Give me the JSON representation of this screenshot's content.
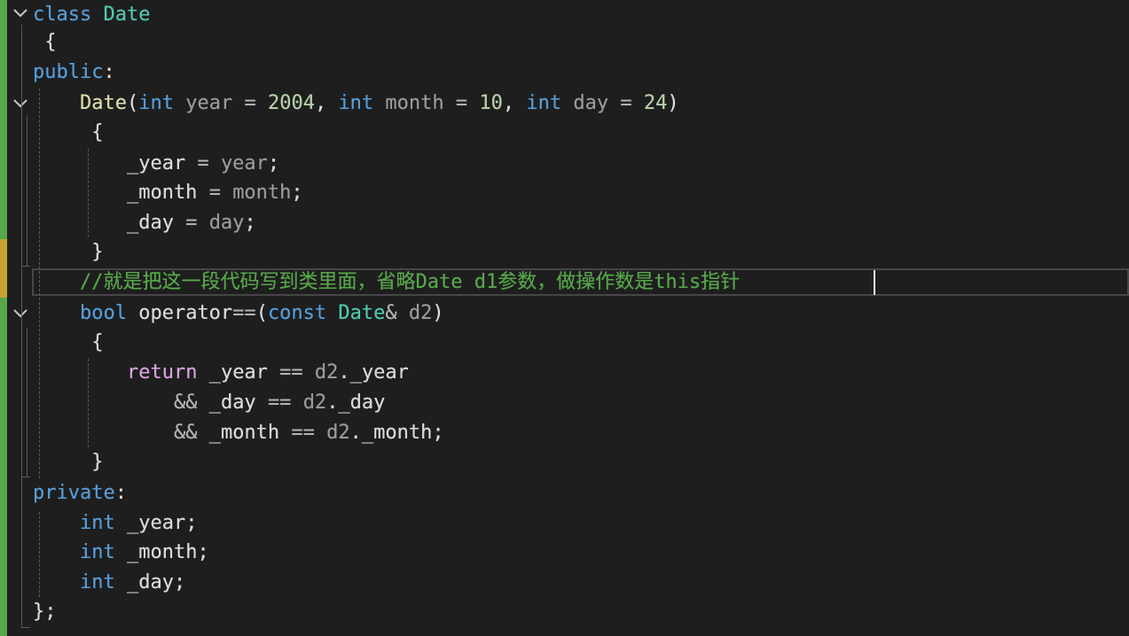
{
  "editor": {
    "theme_colors": {
      "background": "#1e1e1e",
      "keyword": "#569cd6",
      "type": "#4ec9b0",
      "function": "#dcdcaa",
      "number": "#b5cea8",
      "comment": "#57a64a",
      "parameter": "#9a9a9a",
      "control": "#d8a0df",
      "change_saved": "#57a64a",
      "change_unsaved": "#c5a332"
    },
    "fold_icon": "chevron-down-icon",
    "lines": [
      {
        "tokens": [
          {
            "t": "class",
            "c": "kw"
          },
          {
            "t": " ",
            "c": "id"
          },
          {
            "t": "Date",
            "c": "ty"
          }
        ]
      },
      {
        "tokens": [
          {
            "t": " {",
            "c": "id"
          }
        ]
      },
      {
        "tokens": [
          {
            "t": "public",
            "c": "kw"
          },
          {
            "t": ":",
            "c": "id"
          }
        ]
      },
      {
        "tokens": [
          {
            "t": "    ",
            "c": "id"
          },
          {
            "t": "Date",
            "c": "fn"
          },
          {
            "t": "(",
            "c": "id"
          },
          {
            "t": "int",
            "c": "kw"
          },
          {
            "t": " year ",
            "c": "pm"
          },
          {
            "t": "= ",
            "c": "op"
          },
          {
            "t": "2004",
            "c": "num"
          },
          {
            "t": ", ",
            "c": "id"
          },
          {
            "t": "int",
            "c": "kw"
          },
          {
            "t": " month ",
            "c": "pm"
          },
          {
            "t": "= ",
            "c": "op"
          },
          {
            "t": "10",
            "c": "num"
          },
          {
            "t": ", ",
            "c": "id"
          },
          {
            "t": "int",
            "c": "kw"
          },
          {
            "t": " day ",
            "c": "pm"
          },
          {
            "t": "= ",
            "c": "op"
          },
          {
            "t": "24",
            "c": "num"
          },
          {
            "t": ")",
            "c": "id"
          }
        ]
      },
      {
        "tokens": [
          {
            "t": "     {",
            "c": "id"
          }
        ]
      },
      {
        "tokens": [
          {
            "t": "        _year ",
            "c": "id"
          },
          {
            "t": "= ",
            "c": "op"
          },
          {
            "t": "year",
            "c": "pm"
          },
          {
            "t": ";",
            "c": "id"
          }
        ]
      },
      {
        "tokens": [
          {
            "t": "        _month ",
            "c": "id"
          },
          {
            "t": "= ",
            "c": "op"
          },
          {
            "t": "month",
            "c": "pm"
          },
          {
            "t": ";",
            "c": "id"
          }
        ]
      },
      {
        "tokens": [
          {
            "t": "        _day ",
            "c": "id"
          },
          {
            "t": "= ",
            "c": "op"
          },
          {
            "t": "day",
            "c": "pm"
          },
          {
            "t": ";",
            "c": "id"
          }
        ]
      },
      {
        "tokens": [
          {
            "t": "     }",
            "c": "id"
          }
        ]
      },
      {
        "tokens": [
          {
            "t": "    ",
            "c": "id"
          },
          {
            "t": "//就是把这一段代码写到类里面，省略Date d1参数，做操作数是this指针",
            "c": "cm"
          }
        ]
      },
      {
        "tokens": [
          {
            "t": "    ",
            "c": "id"
          },
          {
            "t": "bool",
            "c": "kw"
          },
          {
            "t": " operator",
            "c": "id"
          },
          {
            "t": "==",
            "c": "op"
          },
          {
            "t": "(",
            "c": "id"
          },
          {
            "t": "const",
            "c": "kw"
          },
          {
            "t": " ",
            "c": "id"
          },
          {
            "t": "Date",
            "c": "ty"
          },
          {
            "t": "& ",
            "c": "op"
          },
          {
            "t": "d2",
            "c": "pm"
          },
          {
            "t": ")",
            "c": "id"
          }
        ]
      },
      {
        "tokens": [
          {
            "t": "     {",
            "c": "id"
          }
        ]
      },
      {
        "tokens": [
          {
            "t": "        ",
            "c": "id"
          },
          {
            "t": "return",
            "c": "ctl"
          },
          {
            "t": " _year ",
            "c": "id"
          },
          {
            "t": "== ",
            "c": "op"
          },
          {
            "t": "d2",
            "c": "pm"
          },
          {
            "t": "._year",
            "c": "id"
          }
        ]
      },
      {
        "tokens": [
          {
            "t": "            ",
            "c": "id"
          },
          {
            "t": "&&",
            "c": "op"
          },
          {
            "t": " _day ",
            "c": "id"
          },
          {
            "t": "== ",
            "c": "op"
          },
          {
            "t": "d2",
            "c": "pm"
          },
          {
            "t": "._day",
            "c": "id"
          }
        ]
      },
      {
        "tokens": [
          {
            "t": "            ",
            "c": "id"
          },
          {
            "t": "&&",
            "c": "op"
          },
          {
            "t": " _month ",
            "c": "id"
          },
          {
            "t": "== ",
            "c": "op"
          },
          {
            "t": "d2",
            "c": "pm"
          },
          {
            "t": "._month;",
            "c": "id"
          }
        ]
      },
      {
        "tokens": [
          {
            "t": "     }",
            "c": "id"
          }
        ]
      },
      {
        "tokens": [
          {
            "t": "private",
            "c": "kw"
          },
          {
            "t": ":",
            "c": "id"
          }
        ]
      },
      {
        "tokens": [
          {
            "t": "    ",
            "c": "id"
          },
          {
            "t": "int",
            "c": "kw"
          },
          {
            "t": " _year;",
            "c": "id"
          }
        ]
      },
      {
        "tokens": [
          {
            "t": "    ",
            "c": "id"
          },
          {
            "t": "int",
            "c": "kw"
          },
          {
            "t": " _month;",
            "c": "id"
          }
        ]
      },
      {
        "tokens": [
          {
            "t": "    ",
            "c": "id"
          },
          {
            "t": "int",
            "c": "kw"
          },
          {
            "t": " _day;",
            "c": "id"
          }
        ]
      },
      {
        "tokens": [
          {
            "t": "};",
            "c": "id"
          }
        ]
      }
    ]
  }
}
